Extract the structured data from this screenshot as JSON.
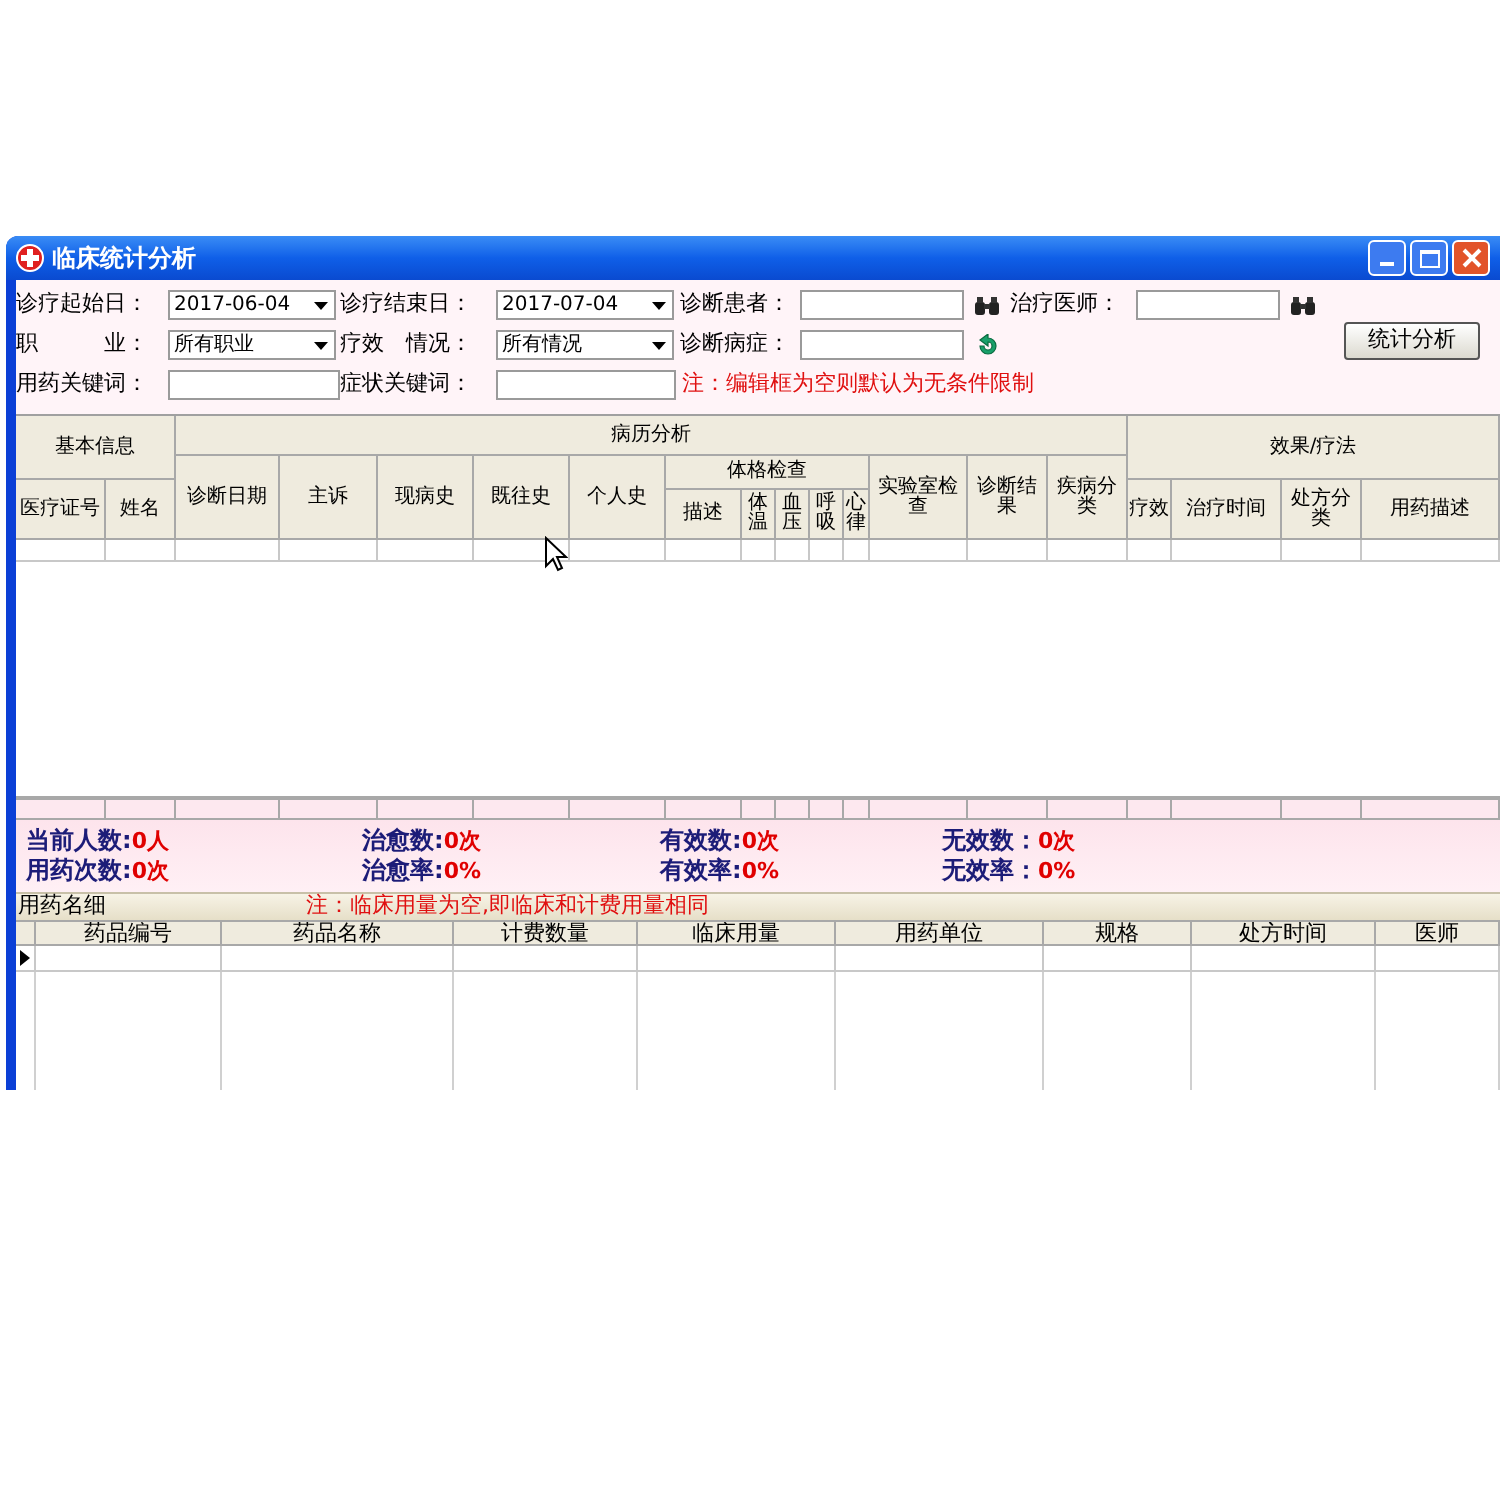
{
  "window": {
    "title": "临床统计分析"
  },
  "filters": [
    {
      "kind": "combo",
      "label": "诊疗起始日：",
      "value": "2017-06-04"
    },
    {
      "kind": "combo",
      "label": "诊疗结束日：",
      "value": "2017-07-04"
    },
    {
      "kind": "search",
      "label": "诊断患者："
    },
    {
      "kind": "search",
      "label": "治疗医师："
    },
    {
      "kind": "combo",
      "label": "职　　　业：",
      "value": "所有职业"
    },
    {
      "kind": "combo",
      "label": "疗效　情况：",
      "value": "所有情况"
    },
    {
      "kind": "reset",
      "label": "诊断病症："
    },
    {
      "kind": "text",
      "label": "用药关键词："
    },
    {
      "kind": "text",
      "label": "症状关键词："
    }
  ],
  "filter_note": "注：编辑框为空则默认为无条件限制",
  "analyze_button": "统计分析",
  "record_table": {
    "headers": [
      "基本信息",
      "医疗证号",
      "姓名",
      "病历分析",
      "诊断日期",
      "主诉",
      "现病史",
      "既往史",
      "个人史",
      "体格检查",
      "描述",
      "体温",
      "血压",
      "呼吸",
      "心律",
      "实验室检查",
      "诊断结果",
      "疾病分类",
      "效果/疗法",
      "疗效",
      "治疗时间",
      "处方分类",
      "用药描述"
    ]
  },
  "stats": [
    {
      "label": "当前人数:",
      "value": "0人"
    },
    {
      "label": "治愈数:",
      "value": "0次"
    },
    {
      "label": "有效数:",
      "value": "0次"
    },
    {
      "label": "无效数：",
      "value": "0次"
    },
    {
      "label": "用药次数:",
      "value": "0次"
    },
    {
      "label": "治愈率:",
      "value": "0%"
    },
    {
      "label": "有效率:",
      "value": "0%"
    },
    {
      "label": "无效率：",
      "value": "0%"
    }
  ],
  "drug_detail": {
    "title": "用药名细",
    "note": "注：临床用量为空,即临床和计费用量相同",
    "columns": [
      "药品编号",
      "药品名称",
      "计费数量",
      "临床用量",
      "用药单位",
      "规格",
      "处方时间",
      "医师"
    ],
    "rows": [
      {
        "selected": true
      }
    ]
  }
}
